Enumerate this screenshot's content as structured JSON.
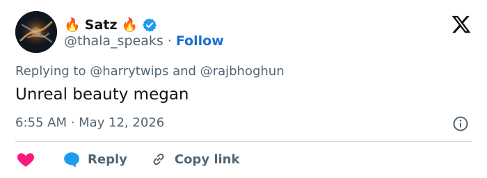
{
  "user": {
    "display_name": "Satz",
    "handle": "@thala_speaks",
    "separator": "·",
    "follow_label": "Follow",
    "emoji_left": "🔥",
    "emoji_right": "🔥",
    "verified": true
  },
  "tweet": {
    "replying_to": "Replying to @harrytwips and @rajbhoghun",
    "text": "Unreal beauty megan",
    "time": "6:55 AM · May 12, 2026"
  },
  "actions": {
    "like_icon": "heart-icon",
    "reply_label": "Reply",
    "copy_link_label": "Copy link"
  },
  "icons": {
    "platform": "x-logo-icon",
    "info": "info-icon",
    "verified": "verified-badge-icon"
  },
  "colors": {
    "link_blue": "#1d6fd1",
    "verified_blue": "#1d9bf0",
    "like_pink": "#f91880",
    "reply_blue": "#1d9bf0",
    "secondary_text": "#536471",
    "primary_text": "#0f1419",
    "divider": "#cfd9de"
  }
}
